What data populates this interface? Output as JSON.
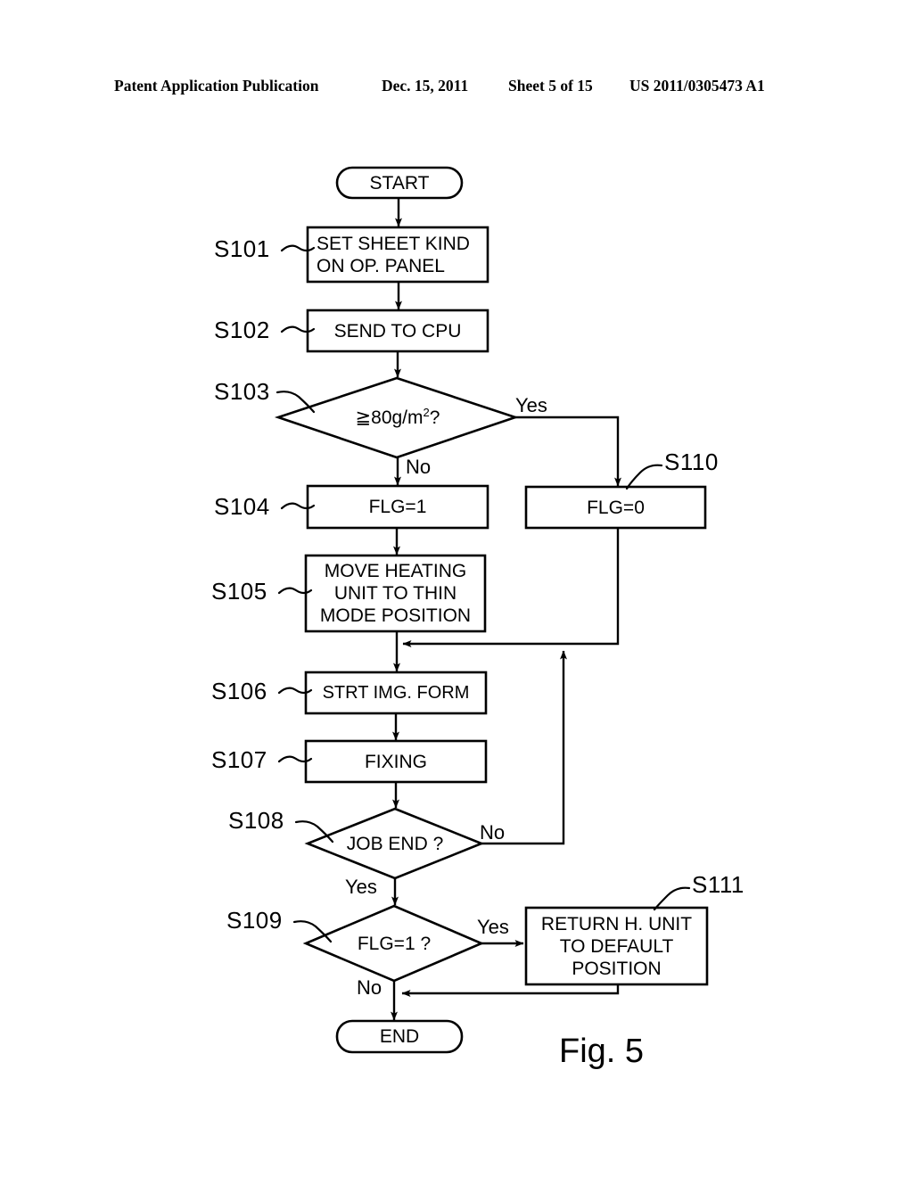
{
  "header": {
    "publication": "Patent Application Publication",
    "date": "Dec. 15, 2011",
    "sheet": "Sheet 5 of 15",
    "number": "US 2011/0305473 A1"
  },
  "figure": {
    "caption": "Fig. 5",
    "ink_color": "#000000",
    "background_color": "#ffffff"
  },
  "flowchart": {
    "terminals": {
      "start": "START",
      "end": "END"
    },
    "steps": [
      {
        "id": "S101",
        "label": "S101",
        "text": "SET SHEET KIND\nON OP. PANEL",
        "shape": "process"
      },
      {
        "id": "S102",
        "label": "S102",
        "text": "SEND TO CPU",
        "shape": "process"
      },
      {
        "id": "S103",
        "label": "S103",
        "text": "≧ 80g/m2?",
        "shape": "decision"
      },
      {
        "id": "S104",
        "label": "S104",
        "text": "FLG=1",
        "shape": "process"
      },
      {
        "id": "S105",
        "label": "S105",
        "text": "MOVE HEATING\nUNIT TO THIN\nMODE POSITION",
        "shape": "process"
      },
      {
        "id": "S106",
        "label": "S106",
        "text": "STRT IMG. FORM",
        "shape": "process"
      },
      {
        "id": "S107",
        "label": "S107",
        "text": "FIXING",
        "shape": "process"
      },
      {
        "id": "S108",
        "label": "S108",
        "text": "JOB END ?",
        "shape": "decision"
      },
      {
        "id": "S109",
        "label": "S109",
        "text": "FLG=1  ?",
        "shape": "decision"
      },
      {
        "id": "S110",
        "label": "S110",
        "text": "FLG=0",
        "shape": "process"
      },
      {
        "id": "S111",
        "label": "S111",
        "text": "RETURN H. UNIT\nTO DEFAULT\nPOSITION",
        "shape": "process"
      }
    ],
    "branches": [
      {
        "from": "S103",
        "answer": "Yes",
        "to": "S110"
      },
      {
        "from": "S103",
        "answer": "No",
        "to": "S104"
      },
      {
        "from": "S108",
        "answer": "No",
        "to": "S106"
      },
      {
        "from": "S108",
        "answer": "Yes",
        "to": "S109"
      },
      {
        "from": "S109",
        "answer": "Yes",
        "to": "S111"
      },
      {
        "from": "S109",
        "answer": "No",
        "to": "END"
      }
    ],
    "branch_text": {
      "s103_yes": "Yes",
      "s103_no": "No",
      "s108_no": "No",
      "s108_yes": "Yes",
      "s109_yes": "Yes",
      "s109_no": "No"
    }
  }
}
